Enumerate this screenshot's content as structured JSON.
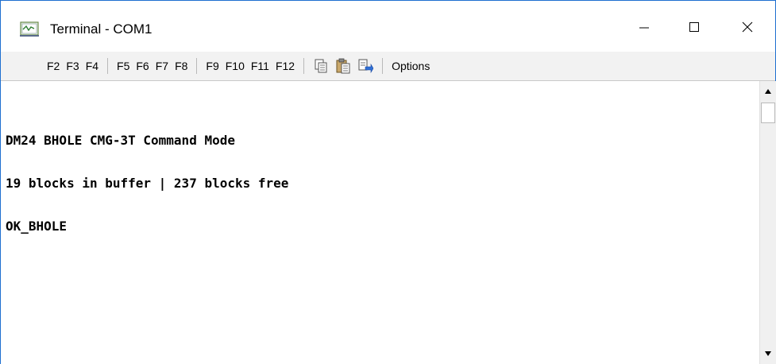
{
  "window": {
    "title": "Terminal - COM1",
    "controls": {
      "minimize": "minimize-icon",
      "maximize": "maximize-icon",
      "close": "close-icon"
    }
  },
  "toolbar": {
    "group1": [
      "F2",
      "F3",
      "F4"
    ],
    "group2": [
      "F5",
      "F6",
      "F7",
      "F8"
    ],
    "group3": [
      "F9",
      "F10",
      "F11",
      "F12"
    ],
    "icons": [
      "copy-icon",
      "paste-icon",
      "send-file-icon"
    ],
    "options_label": "Options"
  },
  "terminal": {
    "lines": [
      "DM24 BHOLE CMG-3T Command Mode",
      "19 blocks in buffer | 237 blocks free",
      "OK_BHOLE"
    ]
  },
  "colors": {
    "window_border": "#1e6fd0",
    "toolbar_bg": "#f2f2f2",
    "terminal_bg": "#ffffff",
    "terminal_text": "#000000"
  }
}
